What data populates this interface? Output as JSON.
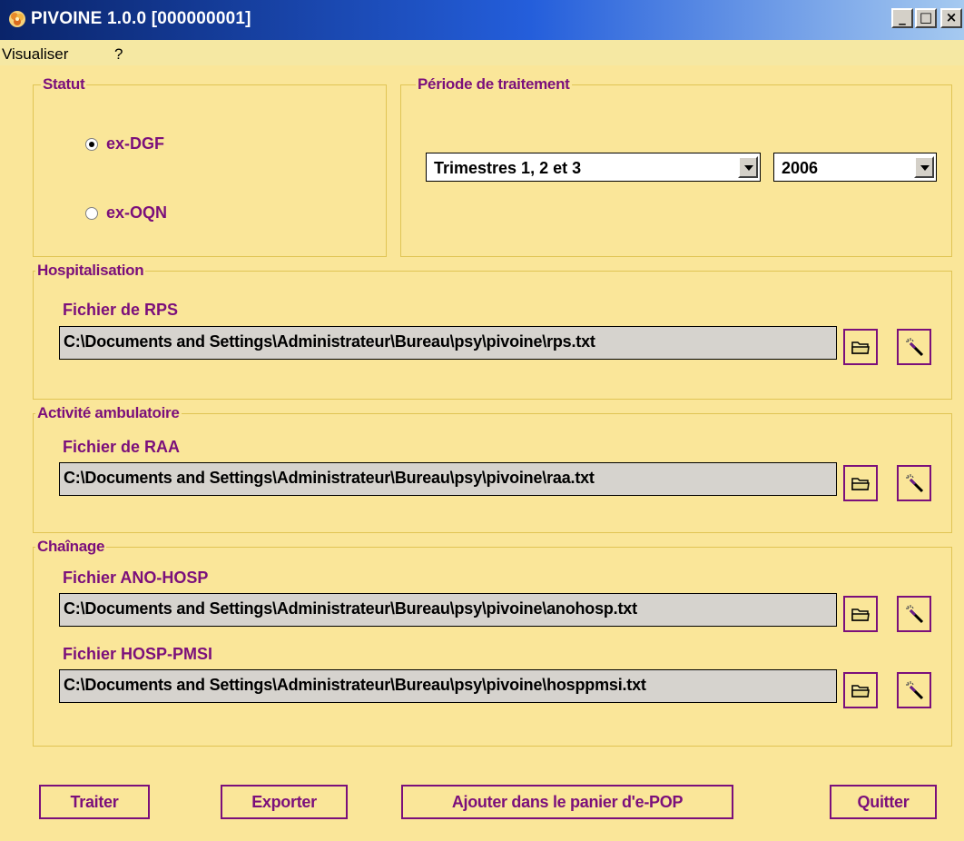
{
  "window": {
    "title": "PIVOINE 1.0.0  [000000001]",
    "min_glyph": "_",
    "max_glyph": "□",
    "close_glyph": "×"
  },
  "menu": [
    "Visualiser",
    "?"
  ],
  "statut": {
    "title": "Statut",
    "options": [
      {
        "label": "ex-DGF",
        "checked": true
      },
      {
        "label": "ex-OQN",
        "checked": false
      }
    ]
  },
  "periode": {
    "title": "Période de traitement",
    "trimestre": "Trimestres 1, 2 et 3",
    "annee": "2006"
  },
  "hospitalisation": {
    "title": "Hospitalisation",
    "label": "Fichier de RPS",
    "path": "C:\\Documents and Settings\\Administrateur\\Bureau\\psy\\pivoine\\rps.txt"
  },
  "ambulatoire": {
    "title": "Activité ambulatoire",
    "label": "Fichier de RAA",
    "path": "C:\\Documents and Settings\\Administrateur\\Bureau\\psy\\pivoine\\raa.txt"
  },
  "chainage": {
    "title": "Chaînage",
    "ano_label": "Fichier ANO-HOSP",
    "ano_path": "C:\\Documents and Settings\\Administrateur\\Bureau\\psy\\pivoine\\anohosp.txt",
    "pmsi_label": "Fichier HOSP-PMSI",
    "pmsi_path": "C:\\Documents and Settings\\Administrateur\\Bureau\\psy\\pivoine\\hosppmsi.txt"
  },
  "actions": {
    "traiter": "Traiter",
    "exporter": "Exporter",
    "ajouter": "Ajouter dans le panier d'e-POP",
    "quitter": "Quitter"
  },
  "colors": {
    "background": "#fae699",
    "accent": "#7b0f7b",
    "titlebar": "#0a246a"
  }
}
